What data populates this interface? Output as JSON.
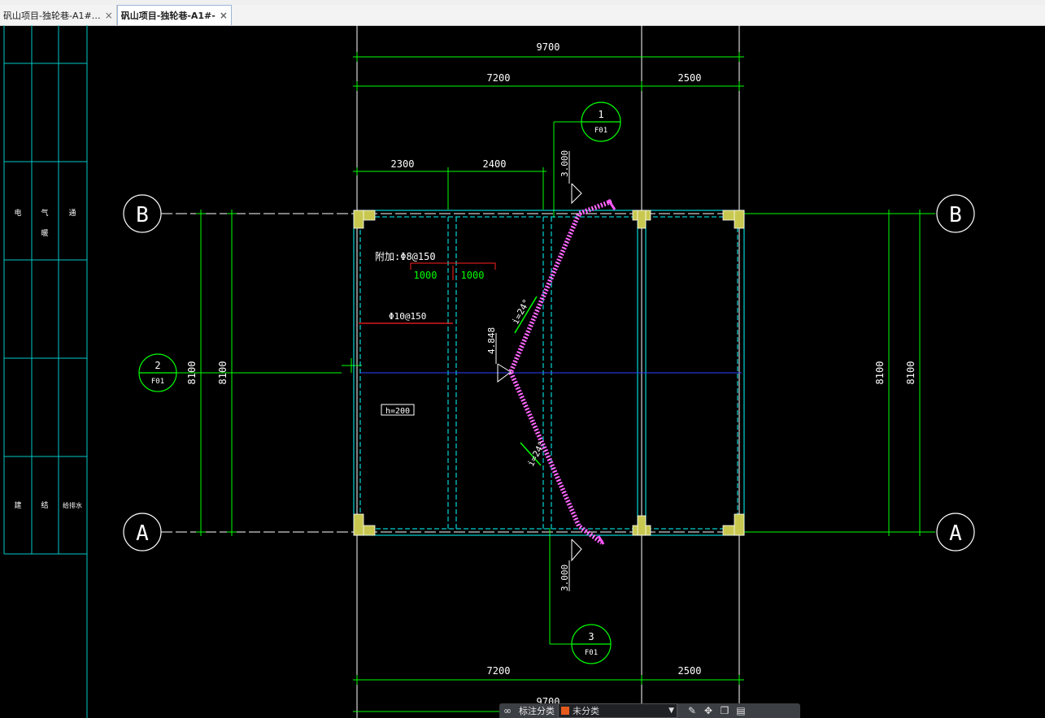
{
  "tabs": [
    {
      "label": "矾山项目-独轮巷-A1#…",
      "active": false
    },
    {
      "label": "矾山项目-独轮巷-A1#-",
      "active": true
    }
  ],
  "title_block": {
    "rows": [
      [
        "",
        "",
        ""
      ],
      [
        "电",
        "气",
        "通"
      ],
      [
        "",
        "",
        ""
      ],
      [
        "",
        "",
        ""
      ],
      [
        "建",
        "结",
        "给排水"
      ]
    ],
    "row_labels_2": [
      "暖",
      ""
    ],
    "line_color": "#00c8c8"
  },
  "drawing": {
    "grid_axes": [
      "B",
      "A"
    ],
    "dims_top": {
      "total": "9700",
      "left": "7200",
      "right": "2500"
    },
    "dims_bottom": {
      "left": "7200",
      "right": "2500",
      "total": "9700"
    },
    "dims_sub": {
      "a": "2300",
      "b": "2400"
    },
    "dims_vertical": "8100",
    "section_marks": [
      {
        "num": "1",
        "ref": "F01"
      },
      {
        "num": "2",
        "ref": "F01"
      },
      {
        "num": "3",
        "ref": "F01"
      }
    ],
    "elevations": {
      "top": "3.000",
      "mid": "4.848",
      "bottom": "3.000"
    },
    "slope_labels": [
      "i=24°",
      "i=24°"
    ],
    "rebar_labels": {
      "top": "附加:Φ8@150",
      "left": "Φ10@150"
    },
    "rebar_dims": [
      "1000",
      "1000"
    ],
    "slab_thickness": "h=200",
    "colors": {
      "dimension": "#00ff00",
      "wall": "#00ffff",
      "grid": "#ffffff",
      "rebar": "#ff2020",
      "stair": "#ff55ff",
      "centerline": "#3040ff",
      "column": "#c8c850"
    }
  },
  "toolbar": {
    "link_icon": "link-icon",
    "label": "标注分类",
    "category": "未分类",
    "icons": [
      "edit-icon",
      "move-icon",
      "copy-icon",
      "layers-icon"
    ]
  }
}
